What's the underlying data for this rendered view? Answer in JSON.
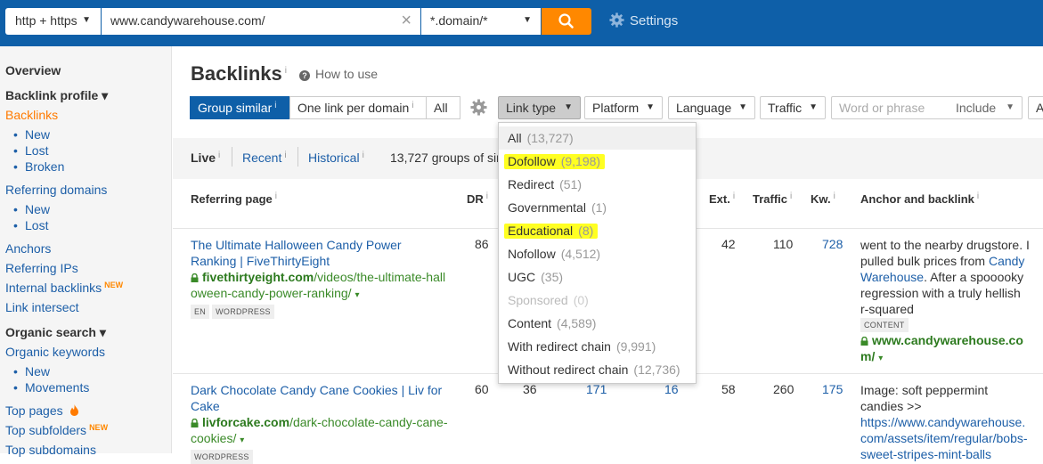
{
  "topbar": {
    "protocol": "http + https",
    "url": "www.candywarehouse.com/",
    "mode": "*.domain/*",
    "settings": "Settings",
    "colors": {
      "bar": "#0e5fa8",
      "search": "#ff8800"
    }
  },
  "sidebar": {
    "overview": "Overview",
    "backlink_profile": "Backlink profile ▾",
    "backlinks": "Backlinks",
    "backlinks_new": "New",
    "backlinks_lost": "Lost",
    "backlinks_broken": "Broken",
    "referring_domains": "Referring domains",
    "rd_new": "New",
    "rd_lost": "Lost",
    "anchors": "Anchors",
    "referring_ips": "Referring IPs",
    "internal_backlinks": "Internal backlinks",
    "new_badge": "NEW",
    "link_intersect": "Link intersect",
    "organic_search": "Organic search ▾",
    "organic_keywords": "Organic keywords",
    "ok_new": "New",
    "ok_movements": "Movements",
    "top_pages": "Top pages",
    "top_subfolders": "Top subfolders",
    "top_subdomains": "Top subdomains"
  },
  "main": {
    "title": "Backlinks",
    "info": "i",
    "how_to": "How to use",
    "group_similar": "Group similar",
    "one_per_domain": "One link per domain",
    "all": "All",
    "filters": {
      "link_type": "Link type",
      "platform": "Platform",
      "language": "Language",
      "traffic": "Traffic",
      "word_placeholder": "Word or phrase",
      "include": "Include",
      "a": "A"
    },
    "tabs": {
      "live": "Live",
      "recent": "Recent",
      "historical": "Historical"
    },
    "groups_text": "13,727 groups of sim",
    "columns": {
      "referring_page": "Referring page",
      "dr": "DR",
      "ext": "Ext.",
      "traffic": "Traffic",
      "kw": "Kw.",
      "anchor": "Anchor and backlink"
    },
    "rows": [
      {
        "title1": "The Ultimate Halloween Candy Power",
        "title2": "Ranking | FiveThirtyEight",
        "domain": "fivethirtyeight.com",
        "path1": "/videos/the-ultimate-hall",
        "path2": "oween-candy-power-ranking/",
        "tags": [
          "EN",
          "WORDPRESS"
        ],
        "dr": "86",
        "ext": "42",
        "traffic": "110",
        "kw": "728",
        "anchor1": "went to the nearby drugstore. I",
        "anchor2a": "pulled bulk prices from ",
        "anchor2b": "Candy",
        "anchor3a": "Warehouse",
        "anchor3b": ". After a spooooky",
        "anchor4": "regression with a truly hellish",
        "anchor5": "r-squared",
        "anchor_tag": "CONTENT",
        "backlink1": "www.candywarehouse.co",
        "backlink2": "m/"
      },
      {
        "title1": "Dark Chocolate Candy Cane Cookies | Liv for",
        "title2": "Cake",
        "domain": "livforcake.com",
        "path1": "/dark-chocolate-candy-cane-",
        "path2": "cookies/",
        "tag": "WORDPRESS",
        "dr": "60",
        "c2": "36",
        "c3": "171",
        "c4": "16",
        "ext": "58",
        "traffic": "260",
        "kw": "175",
        "anchor1": "Image: soft peppermint",
        "anchor2": "candies >>",
        "anchor3": "https://www.candywarehouse.",
        "anchor4": "com/assets/item/regular/bobs-",
        "anchor5": "sweet-stripes-mint-balls"
      }
    ]
  },
  "link_type_dropdown": [
    {
      "label": "All",
      "count": "(13,727)",
      "selected": true
    },
    {
      "label": "Dofollow",
      "count": "(9,198)",
      "highlight": true
    },
    {
      "label": "Redirect",
      "count": "(51)"
    },
    {
      "label": "Governmental",
      "count": "(1)"
    },
    {
      "label": "Educational",
      "count": "(8)",
      "highlight": true
    },
    {
      "label": "Nofollow",
      "count": "(4,512)"
    },
    {
      "label": "UGC",
      "count": "(35)"
    },
    {
      "label": "Sponsored",
      "count": "(0)",
      "disabled": true
    },
    {
      "label": "Content",
      "count": "(4,589)"
    },
    {
      "label": "With redirect chain",
      "count": "(9,991)"
    },
    {
      "label": "Without redirect chain",
      "count": "(12,736)"
    }
  ]
}
